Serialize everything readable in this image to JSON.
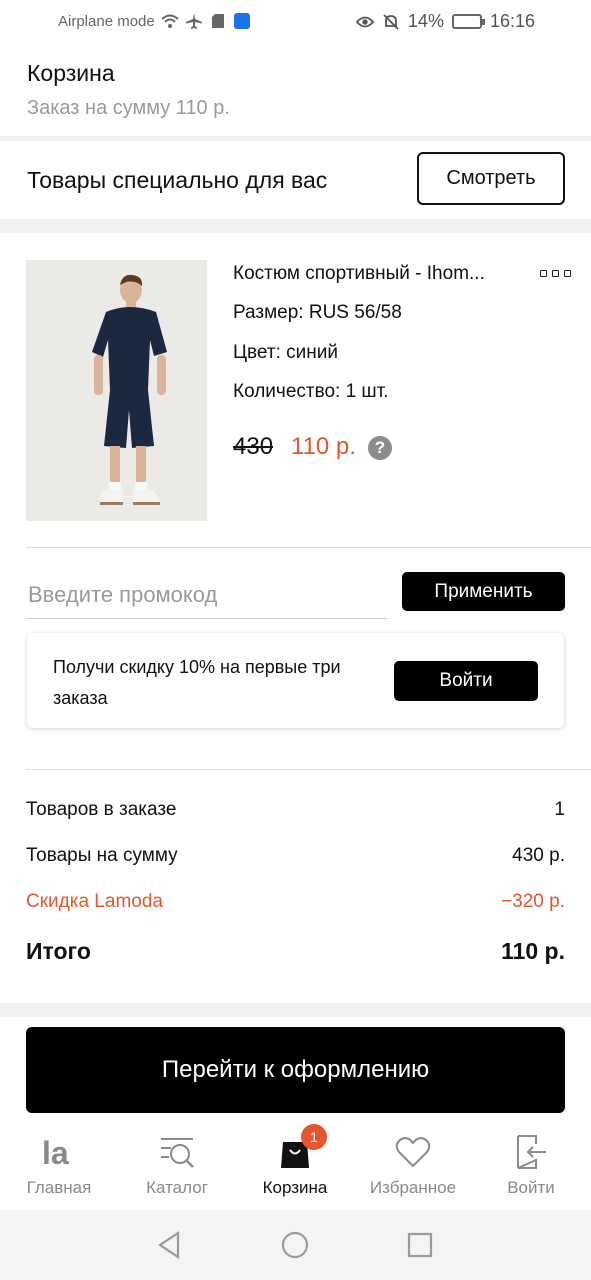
{
  "status_bar": {
    "airplane_label": "Airplane mode",
    "battery": "14%",
    "time": "16:16"
  },
  "header": {
    "title": "Корзина",
    "subtitle": "Заказ на сумму 110 р."
  },
  "for_you": {
    "text": "Товары специально для вас",
    "button": "Смотреть"
  },
  "product": {
    "name": "Костюм спортивный - Ihom...",
    "size": "Размер: RUS 56/58",
    "color": "Цвет: синий",
    "quantity": "Количество: 1 шт.",
    "old_price": "430",
    "new_price": "110 р.",
    "help": "?"
  },
  "promo": {
    "placeholder": "Введите промокод",
    "apply": "Применить"
  },
  "discount_card": {
    "text": "Получи скидку 10% на первые три заказа",
    "button": "Войти"
  },
  "summary": {
    "items_label": "Товаров в заказе",
    "items_value": "1",
    "sum_label": "Товары на сумму",
    "sum_value": "430 р.",
    "discount_label": "Скидка Lamoda",
    "discount_value": "−320 р.",
    "total_label": "Итого",
    "total_value": "110 р."
  },
  "checkout": {
    "label": "Перейти к оформлению"
  },
  "bottom_nav": {
    "items": [
      {
        "label": "Главная",
        "icon": "lamoda-logo-icon"
      },
      {
        "label": "Каталог",
        "icon": "catalog-icon"
      },
      {
        "label": "Корзина",
        "icon": "cart-bag-icon",
        "badge": "1",
        "active": true
      },
      {
        "label": "Избранное",
        "icon": "heart-icon"
      },
      {
        "label": "Войти",
        "icon": "login-icon"
      }
    ]
  },
  "colors": {
    "accent": "#e4572e",
    "primary": "#000000",
    "muted": "#9a9a9a"
  }
}
